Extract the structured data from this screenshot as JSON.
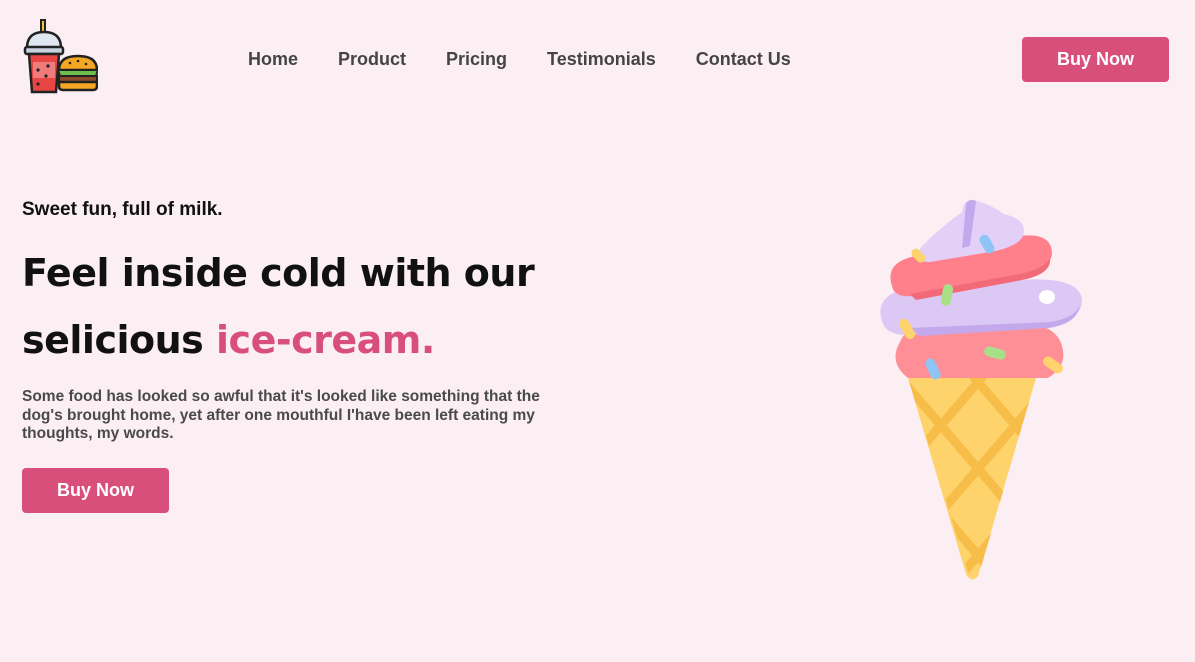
{
  "header": {
    "logo_icon": "drink-and-burger-icon",
    "nav": [
      {
        "label": "Home"
      },
      {
        "label": "Product"
      },
      {
        "label": "Pricing"
      },
      {
        "label": "Testimonials"
      },
      {
        "label": "Contact Us"
      }
    ],
    "buy_label": "Buy Now"
  },
  "hero": {
    "tagline": "Sweet fun, full of milk.",
    "headline_line1": "Feel inside cold with our",
    "headline_line2": "selicious",
    "headline_accent": "ice-cream.",
    "description": "Some food has looked so awful that it's looked like something that the dog's brought home, yet after one mouthful I'have been left eating my thoughts, my words.",
    "buy_label": "Buy Now",
    "illustration_icon": "ice-cream-cone-icon"
  },
  "colors": {
    "background": "#fbeff3",
    "accent": "#d84f7c",
    "nav_text": "#444444"
  }
}
